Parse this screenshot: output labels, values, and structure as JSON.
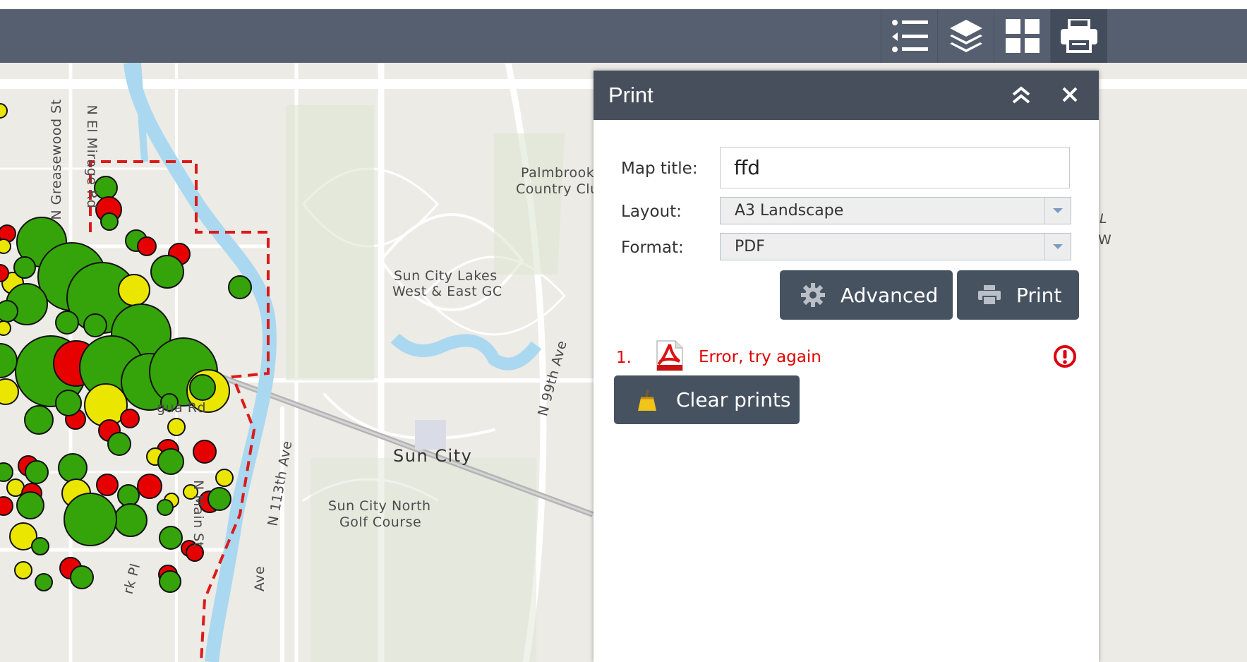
{
  "toolbar": {
    "buttons": [
      {
        "name": "legend",
        "icon": "list-icon"
      },
      {
        "name": "layers",
        "icon": "layers-icon"
      },
      {
        "name": "basemap",
        "icon": "grid-icon"
      },
      {
        "name": "print",
        "icon": "printer-icon",
        "active": true
      }
    ],
    "background": "#555f70"
  },
  "map": {
    "labels": {
      "greasewood": "N Greasewood St",
      "mirage": "N El Mirage Rd",
      "palmbrook_1": "Palmbrook",
      "palmbrook_2": "Country Clu",
      "lakes_1": "Sun City Lakes",
      "lakes_2": "West & East GC",
      "ave99": "N 99th Ave",
      "suncity": "Sun City",
      "ave113": "N 113th Ave",
      "north_1": "Sun City North",
      "north_2": "Golf Course",
      "main": "N Main St",
      "pl": "rk Pl",
      "ave_bottom": "Ave",
      "partial": "gua Rd",
      "edge1": "L",
      "edge2": "W"
    },
    "marker_colors": {
      "green": "#35a30a",
      "red": "#e60000",
      "yellow": "#ebe600"
    }
  },
  "print_panel": {
    "title": "Print",
    "map_title_label": "Map title:",
    "map_title_value": "ffd",
    "layout_label": "Layout:",
    "layout_value": "A3 Landscape",
    "format_label": "Format:",
    "format_value": "PDF",
    "advanced_button": "Advanced",
    "print_button": "Print",
    "results": [
      {
        "index": "1.",
        "icon": "pdf-icon",
        "status": "Error, try again",
        "status_icon": "error-icon"
      }
    ],
    "clear_button": "Clear prints",
    "error_color": "#e00000"
  }
}
